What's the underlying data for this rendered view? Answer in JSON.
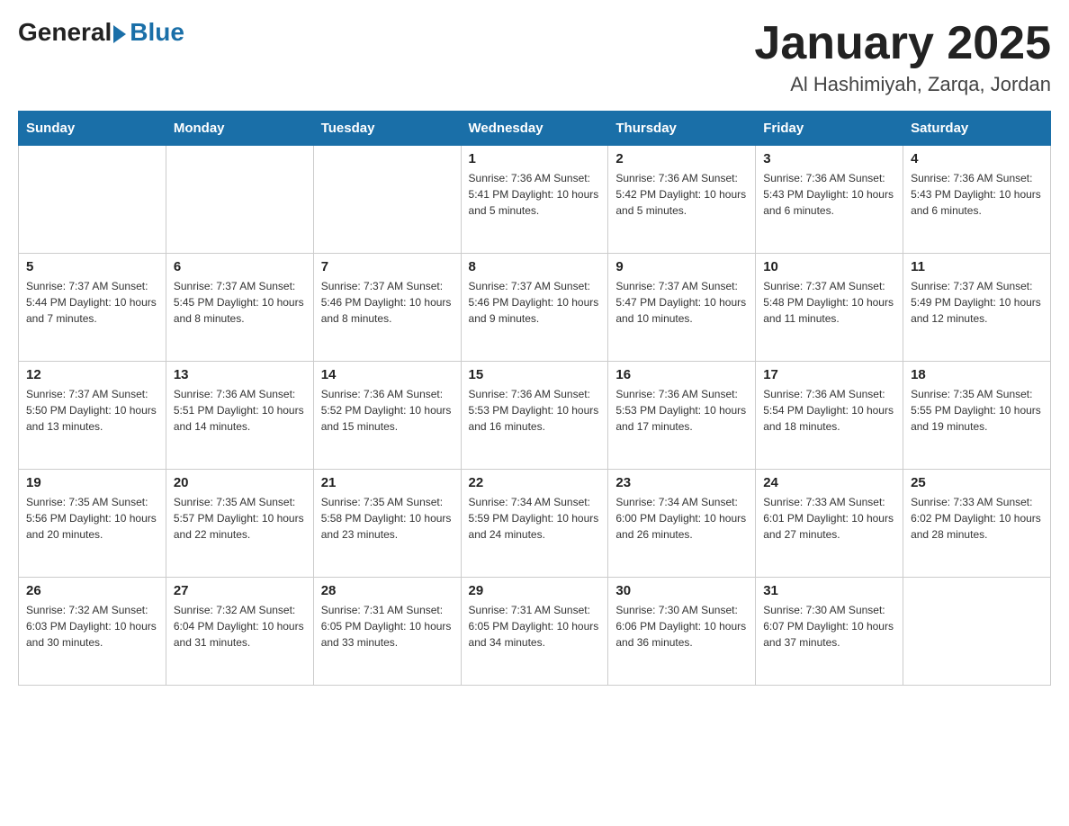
{
  "header": {
    "logo_general": "General",
    "logo_blue": "Blue",
    "month_title": "January 2025",
    "location": "Al Hashimiyah, Zarqa, Jordan"
  },
  "days_of_week": [
    "Sunday",
    "Monday",
    "Tuesday",
    "Wednesday",
    "Thursday",
    "Friday",
    "Saturday"
  ],
  "weeks": [
    [
      {
        "day": "",
        "info": ""
      },
      {
        "day": "",
        "info": ""
      },
      {
        "day": "",
        "info": ""
      },
      {
        "day": "1",
        "info": "Sunrise: 7:36 AM\nSunset: 5:41 PM\nDaylight: 10 hours and 5 minutes."
      },
      {
        "day": "2",
        "info": "Sunrise: 7:36 AM\nSunset: 5:42 PM\nDaylight: 10 hours and 5 minutes."
      },
      {
        "day": "3",
        "info": "Sunrise: 7:36 AM\nSunset: 5:43 PM\nDaylight: 10 hours and 6 minutes."
      },
      {
        "day": "4",
        "info": "Sunrise: 7:36 AM\nSunset: 5:43 PM\nDaylight: 10 hours and 6 minutes."
      }
    ],
    [
      {
        "day": "5",
        "info": "Sunrise: 7:37 AM\nSunset: 5:44 PM\nDaylight: 10 hours and 7 minutes."
      },
      {
        "day": "6",
        "info": "Sunrise: 7:37 AM\nSunset: 5:45 PM\nDaylight: 10 hours and 8 minutes."
      },
      {
        "day": "7",
        "info": "Sunrise: 7:37 AM\nSunset: 5:46 PM\nDaylight: 10 hours and 8 minutes."
      },
      {
        "day": "8",
        "info": "Sunrise: 7:37 AM\nSunset: 5:46 PM\nDaylight: 10 hours and 9 minutes."
      },
      {
        "day": "9",
        "info": "Sunrise: 7:37 AM\nSunset: 5:47 PM\nDaylight: 10 hours and 10 minutes."
      },
      {
        "day": "10",
        "info": "Sunrise: 7:37 AM\nSunset: 5:48 PM\nDaylight: 10 hours and 11 minutes."
      },
      {
        "day": "11",
        "info": "Sunrise: 7:37 AM\nSunset: 5:49 PM\nDaylight: 10 hours and 12 minutes."
      }
    ],
    [
      {
        "day": "12",
        "info": "Sunrise: 7:37 AM\nSunset: 5:50 PM\nDaylight: 10 hours and 13 minutes."
      },
      {
        "day": "13",
        "info": "Sunrise: 7:36 AM\nSunset: 5:51 PM\nDaylight: 10 hours and 14 minutes."
      },
      {
        "day": "14",
        "info": "Sunrise: 7:36 AM\nSunset: 5:52 PM\nDaylight: 10 hours and 15 minutes."
      },
      {
        "day": "15",
        "info": "Sunrise: 7:36 AM\nSunset: 5:53 PM\nDaylight: 10 hours and 16 minutes."
      },
      {
        "day": "16",
        "info": "Sunrise: 7:36 AM\nSunset: 5:53 PM\nDaylight: 10 hours and 17 minutes."
      },
      {
        "day": "17",
        "info": "Sunrise: 7:36 AM\nSunset: 5:54 PM\nDaylight: 10 hours and 18 minutes."
      },
      {
        "day": "18",
        "info": "Sunrise: 7:35 AM\nSunset: 5:55 PM\nDaylight: 10 hours and 19 minutes."
      }
    ],
    [
      {
        "day": "19",
        "info": "Sunrise: 7:35 AM\nSunset: 5:56 PM\nDaylight: 10 hours and 20 minutes."
      },
      {
        "day": "20",
        "info": "Sunrise: 7:35 AM\nSunset: 5:57 PM\nDaylight: 10 hours and 22 minutes."
      },
      {
        "day": "21",
        "info": "Sunrise: 7:35 AM\nSunset: 5:58 PM\nDaylight: 10 hours and 23 minutes."
      },
      {
        "day": "22",
        "info": "Sunrise: 7:34 AM\nSunset: 5:59 PM\nDaylight: 10 hours and 24 minutes."
      },
      {
        "day": "23",
        "info": "Sunrise: 7:34 AM\nSunset: 6:00 PM\nDaylight: 10 hours and 26 minutes."
      },
      {
        "day": "24",
        "info": "Sunrise: 7:33 AM\nSunset: 6:01 PM\nDaylight: 10 hours and 27 minutes."
      },
      {
        "day": "25",
        "info": "Sunrise: 7:33 AM\nSunset: 6:02 PM\nDaylight: 10 hours and 28 minutes."
      }
    ],
    [
      {
        "day": "26",
        "info": "Sunrise: 7:32 AM\nSunset: 6:03 PM\nDaylight: 10 hours and 30 minutes."
      },
      {
        "day": "27",
        "info": "Sunrise: 7:32 AM\nSunset: 6:04 PM\nDaylight: 10 hours and 31 minutes."
      },
      {
        "day": "28",
        "info": "Sunrise: 7:31 AM\nSunset: 6:05 PM\nDaylight: 10 hours and 33 minutes."
      },
      {
        "day": "29",
        "info": "Sunrise: 7:31 AM\nSunset: 6:05 PM\nDaylight: 10 hours and 34 minutes."
      },
      {
        "day": "30",
        "info": "Sunrise: 7:30 AM\nSunset: 6:06 PM\nDaylight: 10 hours and 36 minutes."
      },
      {
        "day": "31",
        "info": "Sunrise: 7:30 AM\nSunset: 6:07 PM\nDaylight: 10 hours and 37 minutes."
      },
      {
        "day": "",
        "info": ""
      }
    ]
  ]
}
